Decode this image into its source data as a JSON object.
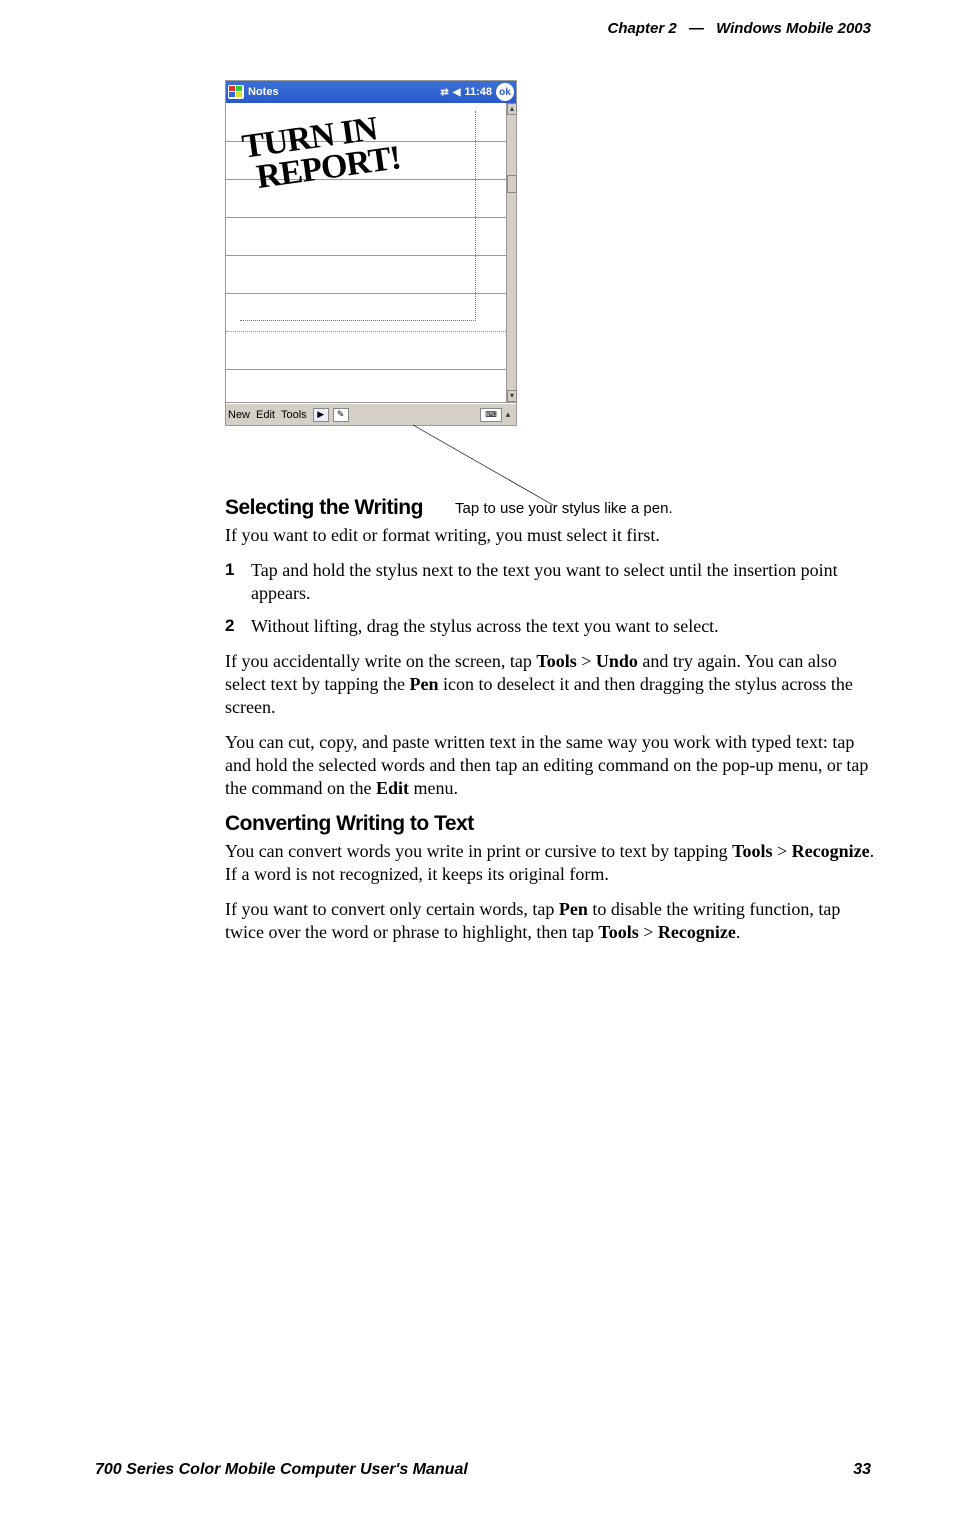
{
  "header": {
    "chapter_label": "Chapter",
    "chapter_num": "2",
    "dash": "—",
    "title": "Windows Mobile 2003"
  },
  "screenshot": {
    "titlebar": {
      "app": "Notes",
      "time": "11:48",
      "ok": "ok"
    },
    "handwriting_l1": "TURN IN",
    "handwriting_l2": "REPORT!",
    "menu": {
      "new": "New",
      "edit": "Edit",
      "tools": "Tools"
    }
  },
  "callout": "Tap to use your stylus like a pen.",
  "sec1_heading": "Selecting the Writing",
  "sec1_intro": "If you want to edit or format writing, you must select it first.",
  "steps": {
    "n1": "1",
    "s1": "Tap and hold the stylus next to the text you want to select until the insertion point appears.",
    "n2": "2",
    "s2": "Without lifting, drag the stylus across the text you want to select."
  },
  "sec1_p2a": "If you accidentally write on the screen, tap ",
  "sec1_p2_tools": "Tools",
  "sec1_p2_gt1": " > ",
  "sec1_p2_undo": "Undo",
  "sec1_p2b": " and try again. You can also select text by tapping the ",
  "sec1_p2_pen": "Pen",
  "sec1_p2c": " icon to deselect it and then dragging the stylus across the screen.",
  "sec1_p3a": "You can cut, copy, and paste written text in the same way you work with typed text: tap and hold the selected words and then tap an editing command on the pop-up menu, or tap the command on the ",
  "sec1_p3_edit": "Edit",
  "sec1_p3b": " menu.",
  "sec2_heading": "Converting Writing to Text",
  "sec2_p1a": "You can convert words you write in print or cursive to text by tapping ",
  "sec2_p1_tools": "Tools",
  "sec2_p1_gt": " > ",
  "sec2_p1_recognize": "Recognize",
  "sec2_p1b": ". If a word is not recognized, it keeps its original form.",
  "sec2_p2a": "If you want to convert only certain words, tap ",
  "sec2_p2_pen": "Pen",
  "sec2_p2b": " to disable the writing function, tap twice over the word or phrase to highlight, then tap ",
  "sec2_p2_tools": "Tools",
  "sec2_p2_gt": " > ",
  "sec2_p2_recognize": "Recognize",
  "sec2_p2c": ".",
  "footer": {
    "left": "700 Series Color Mobile Computer User's Manual",
    "right": "33"
  }
}
